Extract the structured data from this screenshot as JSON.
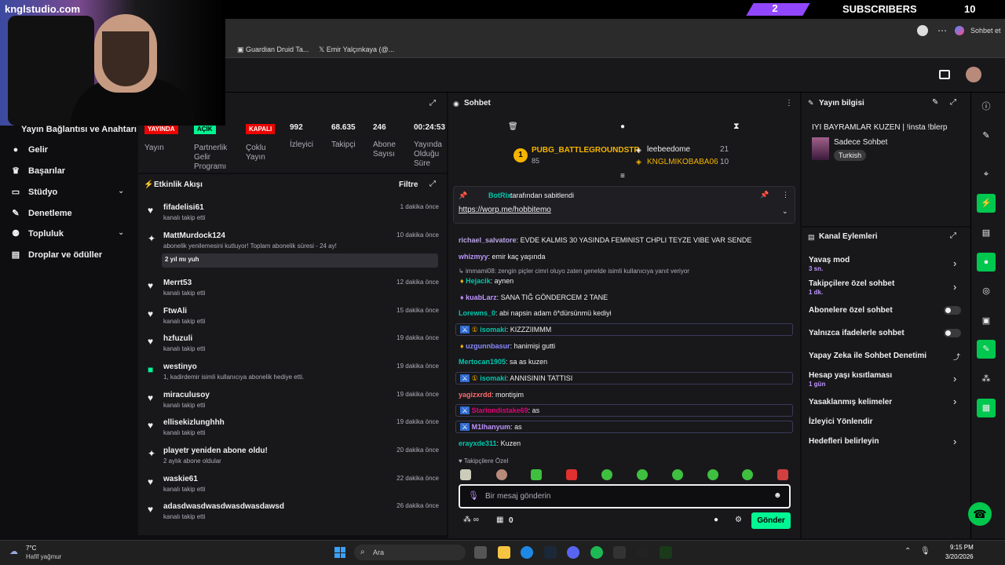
{
  "overlay": {
    "logo": "knglstudio.com",
    "sub_count": "2",
    "sub_label": "SUBSCRIBERS",
    "win_count": "10"
  },
  "browser": {
    "bookmarks": [
      "Guardian Druid Ta...",
      "Emir Yalçınkaya (@..."
    ],
    "chat_btn": "Sohbet et"
  },
  "nav": {
    "section_title": "Yayın Bağlantısı ve Anahtarı",
    "items": [
      {
        "label": "Gelir",
        "icon": "money-icon",
        "chevron": false
      },
      {
        "label": "Başarılar",
        "icon": "trophy-icon",
        "chevron": false
      },
      {
        "label": "Stüdyo",
        "icon": "studio-icon",
        "chevron": true
      },
      {
        "label": "Denetleme",
        "icon": "wrench-icon",
        "chevron": false
      },
      {
        "label": "Topluluk",
        "icon": "community-icon",
        "chevron": true
      },
      {
        "label": "Droplar ve ödüller",
        "icon": "gift-icon",
        "chevron": false
      }
    ]
  },
  "stats": {
    "live_badge": "YAYINDA",
    "live_label": "Yayın",
    "partner_badge": "AÇIK",
    "partner_label": "Partnerlik Gelir Programı",
    "multi_badge": "KAPALI",
    "multi_label": "Çoklu Yayın",
    "viewers": "992",
    "viewers_label": "İzleyici",
    "followers": "68.635",
    "followers_label": "Takipçi",
    "subs": "246",
    "subs_label": "Abone Sayısı",
    "uptime": "00:24:53",
    "uptime_label": "Yayında Olduğu Süre"
  },
  "activity": {
    "title": "Etkinlik Akışı",
    "filter": "Filtre",
    "items": [
      {
        "name": "fifadelisi61",
        "sub": "kanalı takip etti",
        "time": "1 dakika önce",
        "icon": "heart-icon"
      },
      {
        "name": "MattMurdock124",
        "sub": "abonelik yenilemesini kutluyor! Toplam abonelik süresi - 24 ay!",
        "time": "10 dakika önce",
        "icon": "star-icon",
        "note": "2 yıl mı yuh"
      },
      {
        "name": "Merrt53",
        "sub": "kanalı takip etti",
        "time": "12 dakika önce",
        "icon": "heart-icon"
      },
      {
        "name": "FtwAli",
        "sub": "kanalı takip etti",
        "time": "15 dakika önce",
        "icon": "heart-icon"
      },
      {
        "name": "hzfuzuli",
        "sub": "kanalı takip etti",
        "time": "19 dakika önce",
        "icon": "heart-icon"
      },
      {
        "name": "westinyo",
        "sub": "1, kadirdemir isimli kullanıcıya abonelik hediye etti.",
        "time": "19 dakika önce",
        "icon": "gift-icon"
      },
      {
        "name": "miraculusoy",
        "sub": "kanalı takip etti",
        "time": "19 dakika önce",
        "icon": "heart-icon"
      },
      {
        "name": "ellisekizlunghhh",
        "sub": "kanalı takip etti",
        "time": "19 dakika önce",
        "icon": "heart-icon"
      },
      {
        "name": "playetr yeniden abone oldu!",
        "sub": "2 aylık abone oldular",
        "time": "20 dakika önce",
        "icon": "star-icon"
      },
      {
        "name": "waskie61",
        "sub": "kanalı takip etti",
        "time": "22 dakika önce",
        "icon": "heart-icon"
      },
      {
        "name": "adasdwasdwasdwasdwasdawsd",
        "sub": "kanalı takip etti",
        "time": "26 dakika önce",
        "icon": "heart-icon"
      }
    ]
  },
  "chat": {
    "title": "Sohbet",
    "leader1": {
      "name": "PUBG_BATTLEGROUNDSTR",
      "count": "85"
    },
    "leader2": {
      "name": "leebeedome",
      "count": "21"
    },
    "leader3": {
      "name": "KNGLMIKOBABA06",
      "count": "10"
    },
    "pinned_by": "BotRix",
    "pinned_suffix": "tarafından sabitlendi",
    "pinned_link": "https://worp.me/hobbitemo",
    "messages": [
      {
        "user": "richael_salvatore",
        "text": "EVDE KALMIS 30 YASINDA FEMINIST CHPLI TEYZE VIBE VAR SENDE",
        "color": "#b9a3e3"
      },
      {
        "user": "whizmyy",
        "text": "emir kaç yaşında",
        "color": "#bf94ff"
      },
      {
        "user": "Hejacik",
        "text": "aynen",
        "color": "#00c7ac",
        "reply": "immami08: zengin piçler cimri oluyo zaten genelde isimli kullanıcıya yanıt veriyor"
      },
      {
        "user": "kuabLarz",
        "text": "SANA TIĞ GÖNDERCEM 2 TANE",
        "color": "#bf94ff"
      },
      {
        "user": "Lorewns_0",
        "text": "abi napsin adam ö*dürsünmü kediyi",
        "color": "#00c7ac"
      },
      {
        "user": "isomaki",
        "text": "KIZZZIIMMM",
        "color": "#00c7ac"
      },
      {
        "user": "uzgunnbasur",
        "text": "hanimişi gutti",
        "color": "#8a8aff"
      },
      {
        "user": "Mertocan1905",
        "text": "sa as kuzen",
        "color": "#00c7ac"
      },
      {
        "user": "isomaki",
        "text": "ANNISININ TATTISI",
        "color": "#00c7ac"
      },
      {
        "user": "yagizxrdd",
        "text": "montişim",
        "color": "#ff6b6b"
      },
      {
        "user": "Stariondistake69",
        "text": "as",
        "color": "#e5007a"
      },
      {
        "user": "M1lhanyum",
        "text": "as",
        "color": "#bf94ff"
      },
      {
        "user": "erayxde311",
        "text": "Kuzen",
        "color": "#00c7ac"
      }
    ],
    "followers_only": "Takipçilere Özel",
    "input_placeholder": "Bir mesaj gönderin",
    "points": "0",
    "send": "Gönder"
  },
  "info": {
    "title": "Yayın bilgisi",
    "stream_title": "IYI BAYRAMLAR KUZEN | !insta !blerp",
    "category": "Sadece Sohbet",
    "tag": "Turkish"
  },
  "actions": {
    "title": "Kanal Eylemleri",
    "slow_mode": "Yavaş mod",
    "slow_val": "3 sn.",
    "followers_chat": "Takipçilere özel sohbet",
    "followers_val": "1 dk.",
    "subs_chat": "Abonelere özel sohbet",
    "emote_chat": "Yalnızca ifadelerle sohbet",
    "ai_mod": "Yapay Zeka ile Sohbet Denetimi",
    "age": "Hesap yaşı kısıtlaması",
    "age_val": "1 gün",
    "banned": "Yasaklanmış kelimeler",
    "raid": "İzleyici Yönlendir",
    "goals": "Hedefleri belirleyin"
  },
  "taskbar": {
    "weather_temp": "7°C",
    "weather_desc": "Hafif yağmur",
    "search": "Ara",
    "time": "9:15 PM",
    "date": "3/20/2026"
  },
  "colors": {
    "accent": "#9147ff",
    "green": "#00f593",
    "live": "#eb0400"
  }
}
